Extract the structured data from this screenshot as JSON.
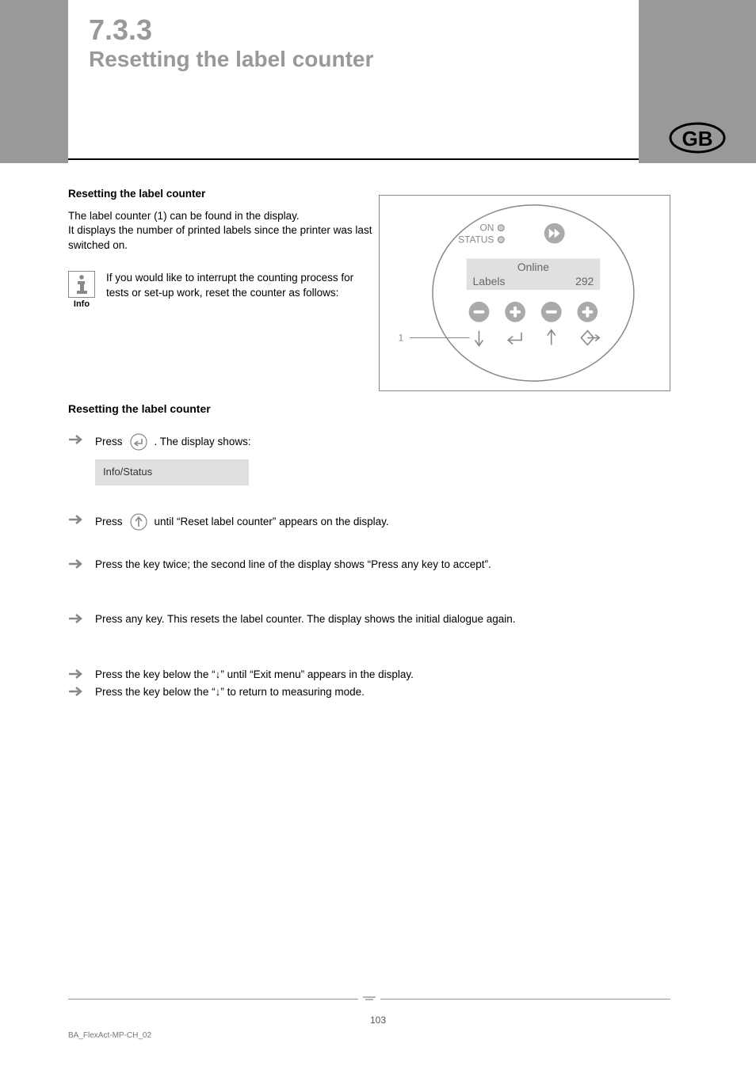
{
  "header": {
    "section_number": "7.3.3",
    "section_title": "Resetting the label counter",
    "lang_badge": "GB"
  },
  "intro": {
    "heading": "Resetting the label counter",
    "line1": "The label counter (1) can be found in the display.",
    "line2": "It displays the number of printed labels since the printer was last switched on."
  },
  "info": {
    "label": "Info",
    "text": "If you would like to interrupt the counting process for tests or set-up work, reset the counter as follows:"
  },
  "subhead": "Resetting the label counter",
  "lcd": {
    "line1": "",
    "line2": "Info/Status"
  },
  "steps": [
    {
      "pre": "Press",
      "post": ". The display shows:"
    },
    {
      "pre": "Press",
      "post": "until “Reset label counter” appears on the display."
    },
    {
      "text": "Press the key twice; the second line of the display shows “Press any key to accept”."
    },
    {
      "text": "Press any key. This resets the label counter. The display shows the initial dialogue again."
    },
    {
      "text": "Press the key below the “↓” until “Exit menu” appears in the display."
    },
    {
      "text": "Press the key below the “↓” to return to measuring mode."
    }
  ],
  "panel": {
    "on": "ON",
    "status": "STATUS",
    "screen_top": "Online",
    "screen_left": "Labels",
    "screen_right": "292",
    "lead_num": "1"
  },
  "footer": {
    "page": "103",
    "ref": "BA_FlexAct-MP-CH_02"
  }
}
